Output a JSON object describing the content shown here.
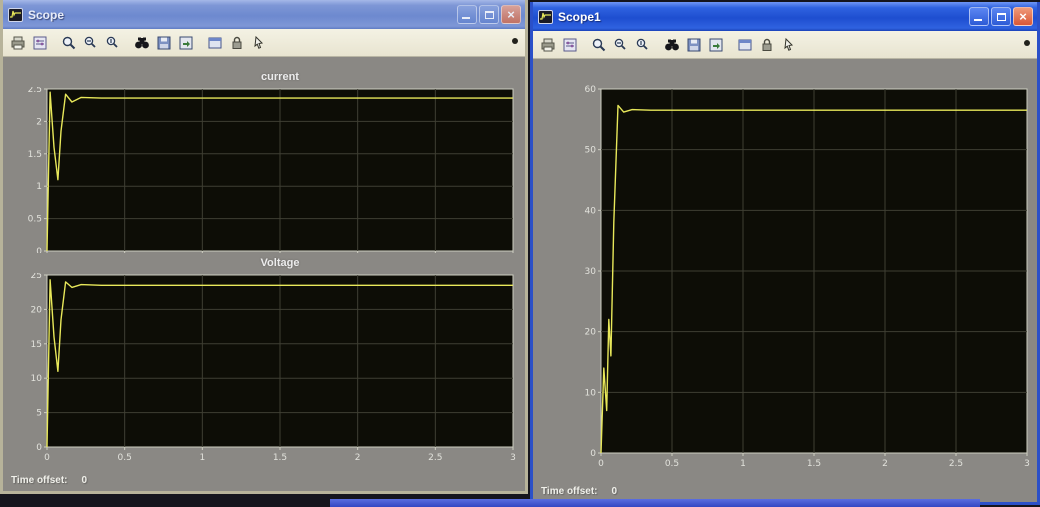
{
  "windows": [
    {
      "title": "Scope",
      "active": false,
      "status_label": "Time offset:",
      "status_value": "0",
      "controls": [
        "minimize",
        "maximize",
        "close"
      ],
      "toolbar_icons": [
        "print-icon",
        "parameters-icon",
        "zoom-icon",
        "zoom-x-icon",
        "zoom-y-icon",
        "autoscale-icon",
        "save-axes-icon",
        "restore-axes-icon",
        "floating-scope-icon",
        "lock-axes-icon",
        "signal-selection-icon"
      ]
    },
    {
      "title": "Scope1",
      "active": true,
      "status_label": "Time offset:",
      "status_value": "0",
      "controls": [
        "minimize",
        "maximize",
        "close"
      ],
      "toolbar_icons": [
        "print-icon",
        "parameters-icon",
        "zoom-icon",
        "zoom-x-icon",
        "zoom-y-icon",
        "autoscale-icon",
        "save-axes-icon",
        "restore-axes-icon",
        "floating-scope-icon",
        "lock-axes-icon",
        "signal-selection-icon"
      ]
    }
  ],
  "colors": {
    "trace": "#e8e85a",
    "plot_background": "#0d0d06",
    "grid": "#3f3f33",
    "axes_frame": "#cfcfc2",
    "figure_background": "#8a8884",
    "active_titlebar": "#2f62e0",
    "inactive_titlebar": "#7e97d6"
  },
  "chart_data": [
    {
      "type": "line",
      "title": "current",
      "xlabel": "",
      "ylabel": "",
      "xlim": [
        0,
        3
      ],
      "ylim": [
        0,
        2.5
      ],
      "xticks": [
        0,
        0.5,
        1,
        1.5,
        2,
        2.5,
        3
      ],
      "yticks": [
        0,
        0.5,
        1,
        1.5,
        2,
        2.5
      ],
      "show_x_labels": false,
      "grid": true,
      "legend": "none",
      "line_color": "#e8e85a",
      "x": [
        0,
        0.02,
        0.045,
        0.07,
        0.09,
        0.12,
        0.16,
        0.22,
        0.35,
        0.6,
        1,
        1.5,
        2,
        2.5,
        3
      ],
      "values": [
        0,
        2.45,
        1.6,
        1.1,
        1.85,
        2.42,
        2.3,
        2.37,
        2.36,
        2.36,
        2.36,
        2.36,
        2.36,
        2.36,
        2.36
      ]
    },
    {
      "type": "line",
      "title": "Voltage",
      "xlabel": "",
      "ylabel": "",
      "xlim": [
        0,
        3
      ],
      "ylim": [
        0,
        25
      ],
      "xticks": [
        0,
        0.5,
        1,
        1.5,
        2,
        2.5,
        3
      ],
      "yticks": [
        0,
        5,
        10,
        15,
        20,
        25
      ],
      "show_x_labels": true,
      "grid": true,
      "legend": "none",
      "line_color": "#e8e85a",
      "x": [
        0,
        0.02,
        0.045,
        0.07,
        0.09,
        0.12,
        0.16,
        0.22,
        0.35,
        0.6,
        1,
        1.5,
        2,
        2.5,
        3
      ],
      "values": [
        0,
        24.3,
        16,
        11,
        18.5,
        24,
        23.2,
        23.6,
        23.5,
        23.5,
        23.5,
        23.5,
        23.5,
        23.5,
        23.5
      ]
    },
    {
      "type": "line",
      "title": "",
      "xlabel": "",
      "ylabel": "",
      "xlim": [
        0,
        3
      ],
      "ylim": [
        0,
        60
      ],
      "xticks": [
        0,
        0.5,
        1,
        1.5,
        2,
        2.5,
        3
      ],
      "yticks": [
        0,
        10,
        20,
        30,
        40,
        50,
        60
      ],
      "show_x_labels": true,
      "grid": true,
      "legend": "none",
      "line_color": "#e8e85a",
      "x": [
        0,
        0.02,
        0.04,
        0.055,
        0.07,
        0.09,
        0.12,
        0.16,
        0.22,
        0.35,
        0.6,
        1,
        1.5,
        2,
        2.5,
        3
      ],
      "values": [
        0,
        14,
        7,
        22,
        16,
        38,
        57.3,
        56.2,
        56.6,
        56.5,
        56.5,
        56.5,
        56.5,
        56.5,
        56.5,
        56.5
      ]
    }
  ]
}
